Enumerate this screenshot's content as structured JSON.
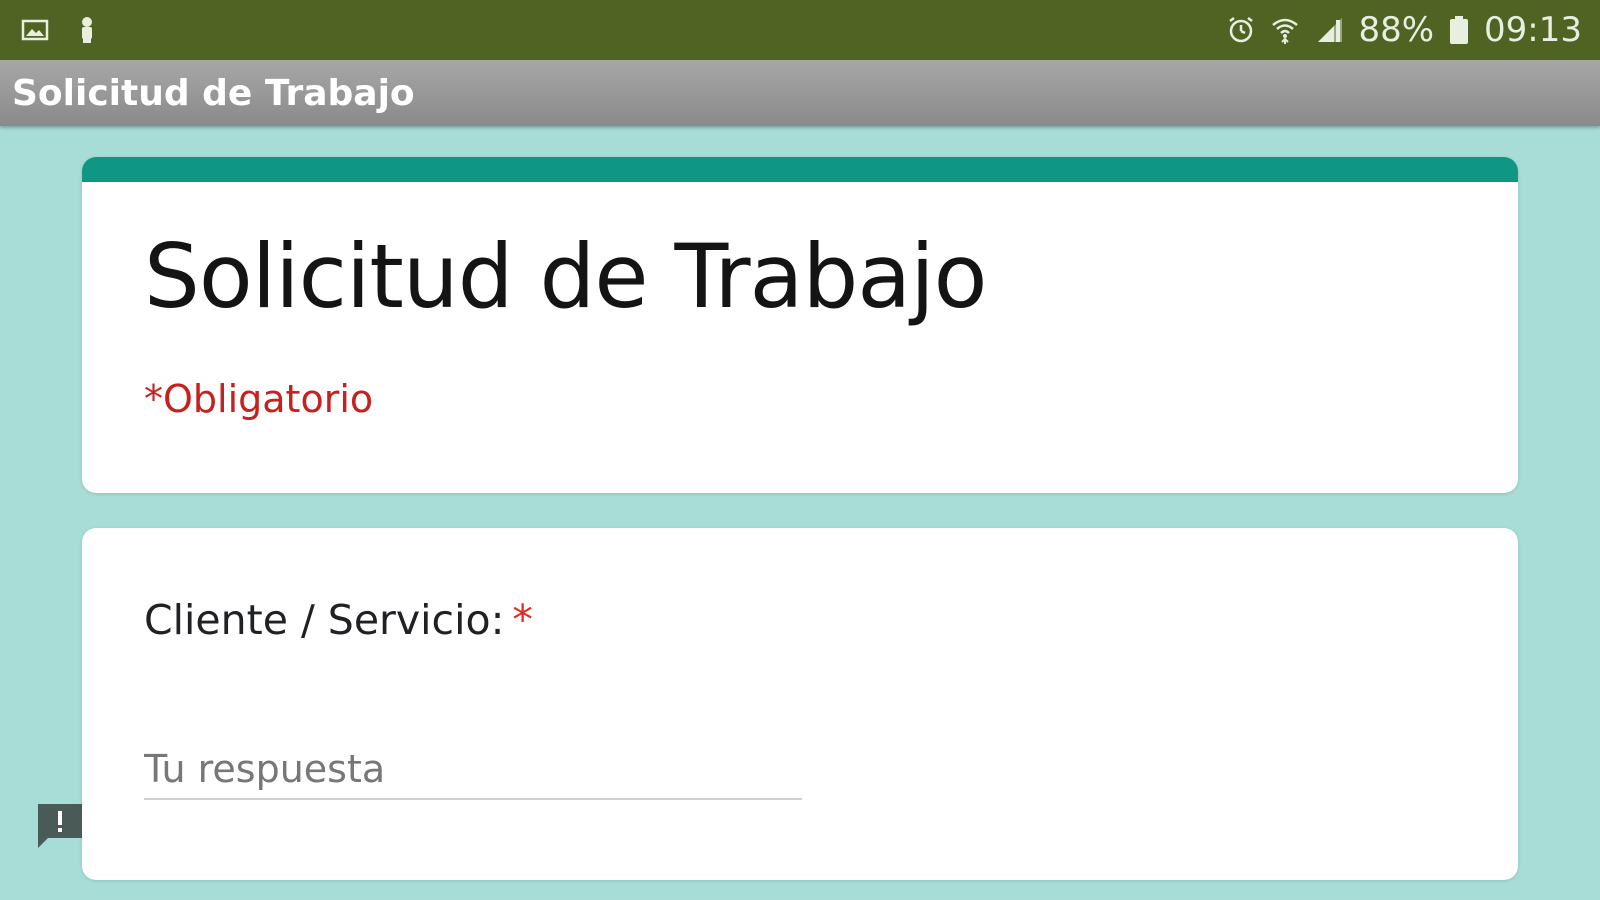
{
  "status_bar": {
    "left_icons": [
      "image-notification-icon",
      "person-notification-icon"
    ],
    "right_icons": [
      "alarm-icon",
      "wifi-icon",
      "cell-signal-icon",
      "battery-icon"
    ],
    "battery_text": "88%",
    "time": "09:13",
    "color": "#4f6323"
  },
  "app_bar": {
    "title": "Solicitud de Trabajo"
  },
  "form": {
    "title": "Solicitud de Trabajo",
    "required_note": "*Obligatorio",
    "accent_color": "#0f9783",
    "background_color": "#a8dcd6",
    "questions": [
      {
        "label": "Cliente / Servicio:",
        "required_marker": "*",
        "placeholder": "Tu respuesta",
        "value": ""
      }
    ]
  },
  "feedback_button": {
    "icon": "feedback-icon"
  }
}
